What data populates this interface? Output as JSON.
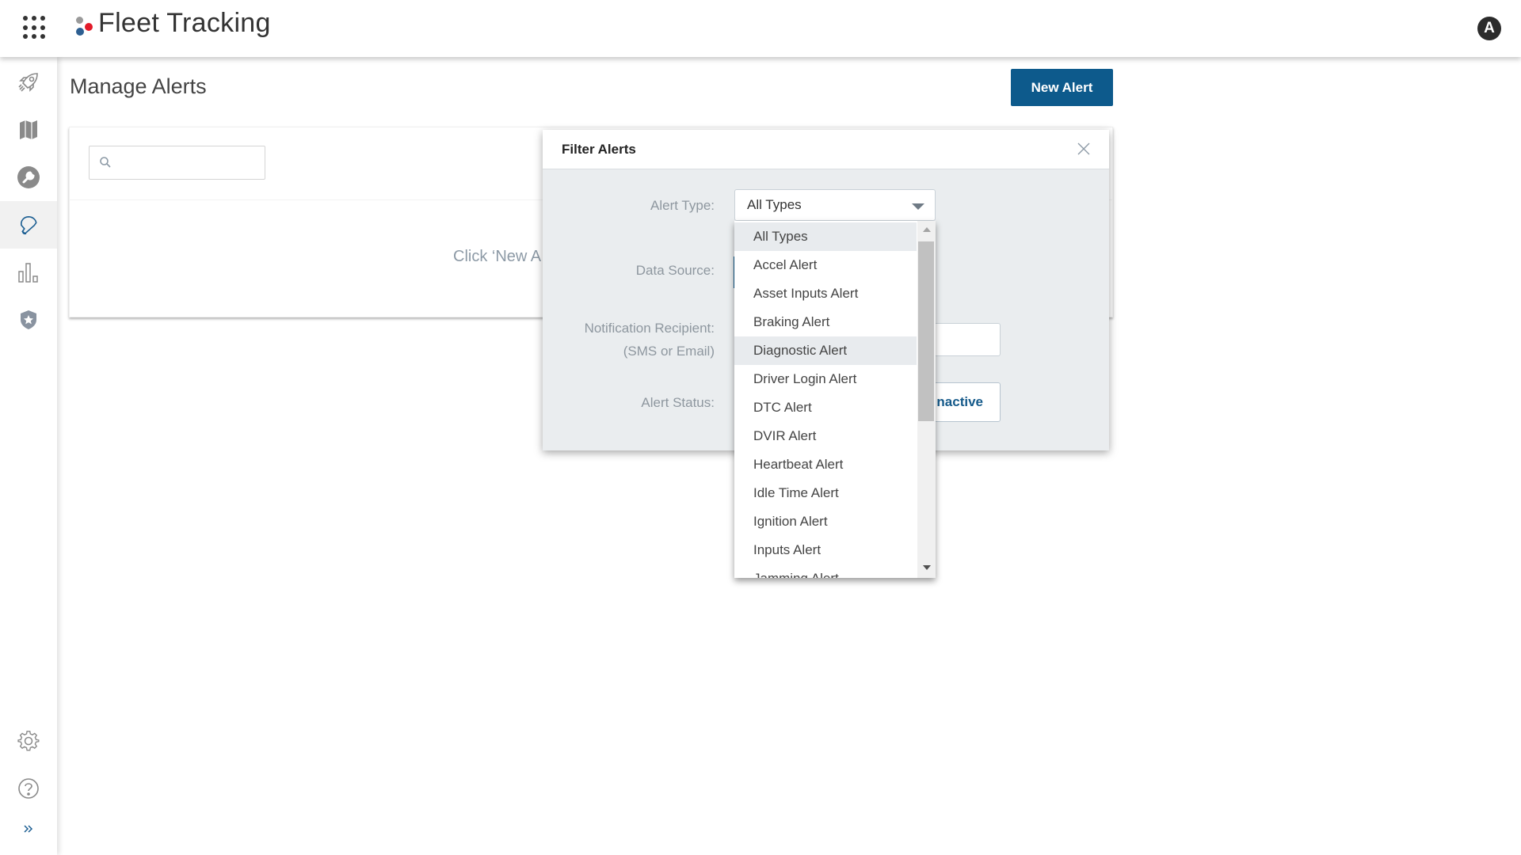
{
  "header": {
    "app_title": "Fleet Tracking",
    "avatar_initial": "A",
    "brand_colors": {
      "dot_gray": "#9a9a9a",
      "dot_blue": "#2d5f91",
      "dot_red": "#e21b2a"
    }
  },
  "sidebar": {
    "items": [
      {
        "icon": "rocket-icon",
        "label": "Getting Started",
        "active": false
      },
      {
        "icon": "map-icon",
        "label": "Map",
        "active": false
      },
      {
        "icon": "wrench-icon",
        "label": "Maintenance",
        "active": false
      },
      {
        "icon": "bell-icon",
        "label": "Alerts",
        "active": true
      },
      {
        "icon": "bar-chart-icon",
        "label": "Reports",
        "active": false
      },
      {
        "icon": "shield-star-icon",
        "label": "Safety",
        "active": false
      }
    ],
    "bottom_items": [
      {
        "icon": "gear-icon",
        "label": "Settings"
      },
      {
        "icon": "help-icon",
        "label": "Help"
      },
      {
        "icon": "expand-chevron-icon",
        "label": "Expand"
      }
    ],
    "accent_color": "#0d5a8c"
  },
  "page": {
    "title": "Manage Alerts",
    "new_alert_label": "New Alert",
    "search_placeholder": "",
    "empty_text": "Click ‘New A"
  },
  "filter_modal": {
    "title": "Filter Alerts",
    "labels": {
      "alert_type": "Alert Type:",
      "data_source": "Data Source:",
      "notification_recipient": "Notification Recipient:",
      "notification_hint": "(SMS or Email)",
      "alert_status": "Alert Status:"
    },
    "alert_type_value": "All Types",
    "notification_value": "",
    "status_button_label": "nactive",
    "alert_type_options": [
      "All Types",
      "Accel Alert",
      "Asset Inputs Alert",
      "Braking Alert",
      "Diagnostic Alert",
      "Driver Login Alert",
      "DTC Alert",
      "DVIR Alert",
      "Heartbeat Alert",
      "Idle Time Alert",
      "Ignition Alert",
      "Inputs Alert",
      "Jamming Alert"
    ],
    "selected_option": "All Types",
    "hovered_option": "Diagnostic Alert"
  }
}
